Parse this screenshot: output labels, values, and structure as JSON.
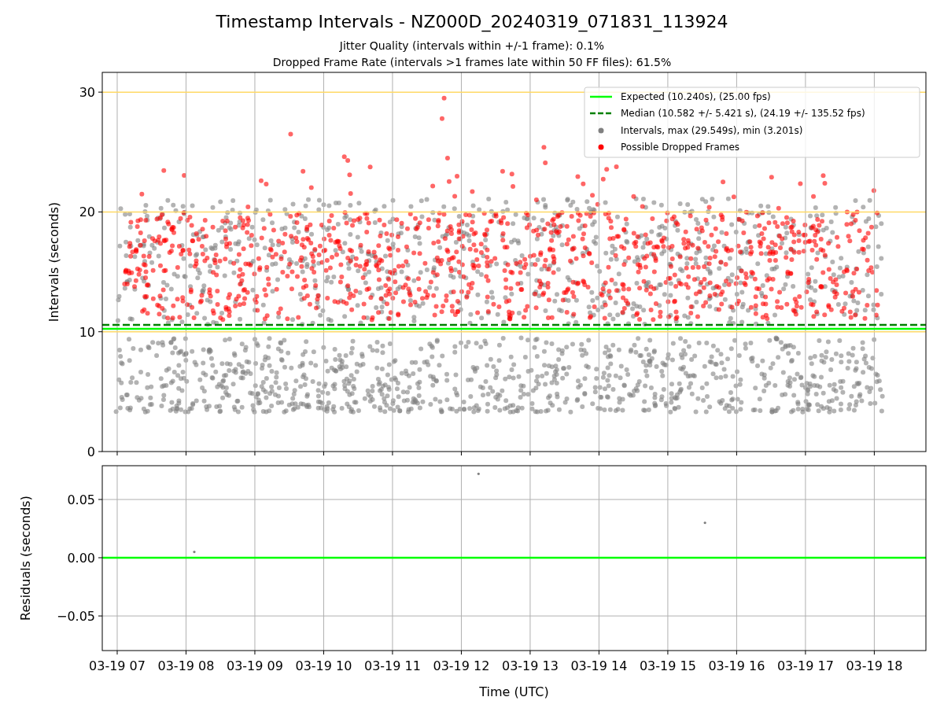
{
  "title": "Timestamp Intervals - NZ000D_20240319_071831_113924",
  "subtitles": [
    "Jitter Quality (intervals within +/-1 frame): 0.1%",
    "Dropped Frame Rate (intervals >1 frames late within 50 FF files): 61.5%"
  ],
  "intervals_plot": {
    "chart_data": {
      "type": "scatter",
      "ylabel": "Intervals (seconds)",
      "grid": true,
      "categories": [
        null,
        null,
        null,
        null,
        null,
        null,
        null,
        null,
        null,
        null,
        null,
        null
      ],
      "ylim": [
        0,
        31.65
      ],
      "yticks": [
        0,
        10,
        20,
        30
      ],
      "ref_lines": [
        {
          "axis": "y",
          "value": 10,
          "color": "#ffd966"
        },
        {
          "axis": "y",
          "value": 20,
          "color": "#ffd966"
        },
        {
          "axis": "y",
          "value": 30,
          "color": "#ffd966"
        },
        {
          "axis": "y",
          "value": 10.24,
          "color": "#00ff00"
        },
        {
          "axis": "y",
          "value": 10.58,
          "color": "#008000"
        }
      ]
    },
    "legend": [
      {
        "label": "Expected (10.240s), (25.00 fps)",
        "color": "#00ff00",
        "kind": "line"
      },
      {
        "label": "Median (10.582 +/- 5.421 s), (24.19 +/- 135.52 fps)",
        "color": "#008000",
        "kind": "dashed"
      },
      {
        "label": "Intervals, max (29.549s), min (3.201s)",
        "color": "#808080",
        "kind": "marker"
      },
      {
        "label": "Possible Dropped Frames",
        "color": "#ff0000",
        "kind": "marker"
      }
    ]
  },
  "residuals_plot": {
    "chart_data": {
      "type": "scatter",
      "xlabel": "Time (UTC)",
      "ylabel": "Residuals (seconds)",
      "grid": true,
      "ylim": [
        -0.0797,
        0.079
      ],
      "yticks": [
        {
          "value": -0.05,
          "label": "−0.05"
        },
        {
          "value": 0,
          "label": "0.00"
        },
        {
          "value": 0.05,
          "label": "0.05"
        }
      ],
      "categories": [
        "03-19 07",
        "03-19 08",
        "03-19 09",
        "03-19 10",
        "03-19 11",
        "03-19 12",
        "03-19 13",
        "03-19 14",
        "03-19 15",
        "03-19 16",
        "03-19 17",
        "03-19 18"
      ],
      "ref_lines": [
        {
          "axis": "y",
          "value": 0,
          "color": "#00ff00"
        }
      ]
    }
  }
}
